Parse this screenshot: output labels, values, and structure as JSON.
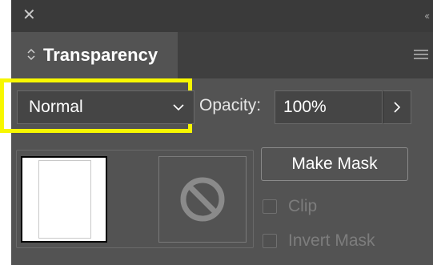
{
  "panel": {
    "tab": {
      "label": "Transparency"
    },
    "blend_mode": {
      "value": "Normal"
    },
    "opacity": {
      "label": "Opacity:",
      "value": "100%"
    },
    "make_mask_label": "Make Mask",
    "clip": {
      "label": "Clip",
      "checked": false,
      "enabled": false
    },
    "invert_mask": {
      "label": "Invert Mask",
      "checked": false,
      "enabled": false
    },
    "highlight_color": "#f7f700"
  },
  "icons": {
    "close": "close-icon",
    "collapse": "double-chevron-left-icon",
    "tab_options": "up-down-arrows-icon",
    "menu": "hamburger-menu-icon",
    "dropdown": "chevron-down-icon",
    "stepper": "chevron-right-icon",
    "no_mask": "prohibited-icon"
  }
}
